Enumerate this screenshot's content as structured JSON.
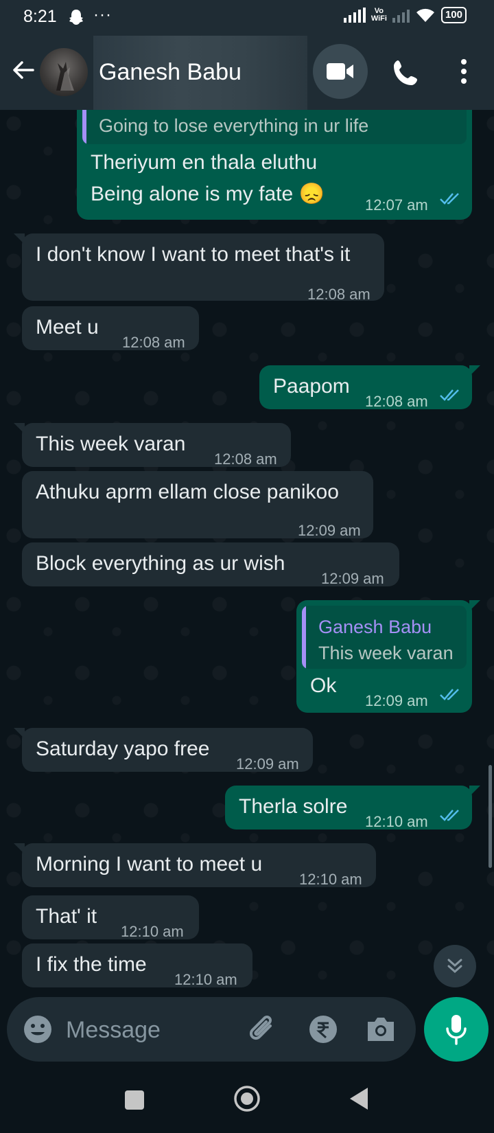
{
  "status_bar": {
    "time": "8:21",
    "dots": "···",
    "vowifi": "Vo\nWiFi",
    "battery": "100"
  },
  "header": {
    "contact_name": "Ganesh Babu"
  },
  "messages": [
    {
      "dir": "out",
      "quote_text": "Going to lose everything in ur life",
      "text": "Theriyum en thala eluthu\nBeing alone is my fate 😞",
      "time": "12:07 am"
    },
    {
      "dir": "in",
      "text": "I don't know I want to meet that's it",
      "time": "12:08 am"
    },
    {
      "dir": "in",
      "text": "Meet u",
      "time": "12:08 am"
    },
    {
      "dir": "out",
      "text": "Paapom",
      "time": "12:08 am"
    },
    {
      "dir": "in",
      "text": "This week varan",
      "time": "12:08 am"
    },
    {
      "dir": "in",
      "text": "Athuku aprm ellam close panikoo",
      "time": "12:09 am"
    },
    {
      "dir": "in",
      "text": "Block everything as ur wish",
      "time": "12:09 am"
    },
    {
      "dir": "out",
      "quote_author": "Ganesh Babu",
      "quote_text": "This week varan",
      "text": "Ok",
      "time": "12:09 am"
    },
    {
      "dir": "in",
      "text": "Saturday yapo free",
      "time": "12:09 am"
    },
    {
      "dir": "out",
      "text": "Therla solre",
      "time": "12:10 am"
    },
    {
      "dir": "in",
      "text": "Morning I want to meet u",
      "time": "12:10 am"
    },
    {
      "dir": "in",
      "text": "That' it",
      "time": "12:10 am"
    },
    {
      "dir": "in",
      "text": "I fix the time",
      "time": "12:10 am"
    }
  ],
  "input": {
    "placeholder": "Message"
  },
  "colors": {
    "incoming_bubble": "#202c33",
    "outgoing_bubble": "#005c4b",
    "accent": "#00a884",
    "read_ticks": "#53bdeb",
    "quote_author": "#a590f6"
  },
  "icons": [
    "back-arrow-icon",
    "video-call-icon",
    "phone-icon",
    "more-vert-icon",
    "double-check-icon",
    "scroll-down-icon",
    "emoji-icon",
    "attach-icon",
    "rupee-icon",
    "camera-icon",
    "mic-icon"
  ]
}
